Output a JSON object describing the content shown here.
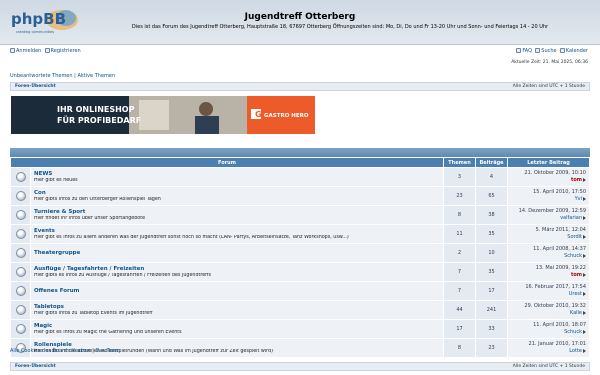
{
  "header": {
    "logo_text": "phpBB",
    "logo_tagline": "creating communities",
    "title": "Jugendtreff Otterberg",
    "description": "Dies ist das Forum des Jugendtreff Otterberg, Hauptstraße 18, 67697 Otterberg Öffnungszeiten sind: Mo, Di, Do und Fr 13-20 Uhr und Sonn- und Feiertags 14 - 20 Uhr"
  },
  "topnav": {
    "login": "Anmelden",
    "register": "Registrieren",
    "faq": "FAQ",
    "search": "Suche",
    "calendar": "Kalender"
  },
  "current_time": "Aktuelle Zeit: 21. Mai 2025, 06:36",
  "quick_links": {
    "unanswered": "Unbeantwortete Themen",
    "separator": "|",
    "active": "Aktive Themen"
  },
  "breadcrumb": {
    "index": "Foren-Übersicht",
    "timezone": "Alle Zeiten sind UTC + 1 Stunde"
  },
  "ad": {
    "line1": "IHR ONLINESHOP",
    "line2": "FÜR PROFIBEDARF",
    "brand": "GASTRO HERO"
  },
  "table": {
    "headers": {
      "forum": "Forum",
      "topics": "Themen",
      "posts": "Beiträge",
      "last_post": "Letzter Beitrag"
    },
    "rows": [
      {
        "name": "NEWS",
        "desc": "Hier gibt es neues",
        "topics": "3",
        "posts": "4",
        "date": "21. Oktober 2009, 10:10",
        "user": "tom",
        "admin": true
      },
      {
        "name": "Con",
        "desc": "Hier gibts Infos zu den Otterberger Rollenspiel Tagen",
        "topics": "23",
        "posts": "65",
        "date": "15. April 2010, 17:50",
        "user": "Yvi",
        "admin": false
      },
      {
        "name": "Turniere & Sport",
        "desc": "Hier findet ihr Infos über unser Sportangebote",
        "topics": "8",
        "posts": "38",
        "date": "14. Dezember 2009, 12:59",
        "user": "valfarian",
        "admin": false
      },
      {
        "name": "Events",
        "desc": "Hier gibt es Infos zu allem anderen was der Jugendtreff sonst noch so macht (LAN- Partys, Arbeitseinsätze, Tanz Workshops, usw...)",
        "topics": "11",
        "posts": "35",
        "date": "5. März 2011, 12:04",
        "user": "Sordit",
        "admin": false
      },
      {
        "name": "Theatergruppe",
        "desc": "",
        "topics": "2",
        "posts": "10",
        "date": "11. April 2008, 14:37",
        "user": "Schuck",
        "admin": false
      },
      {
        "name": "Ausflüge / Tagesfahrten / Freizeiten",
        "desc": "Hier gibts es Infos zu Ausflüge / Tagesfahrten / Freizeiten des Jugendtreffs",
        "topics": "7",
        "posts": "35",
        "date": "13. Mai 2009, 19:22",
        "user": "tom",
        "admin": true
      },
      {
        "name": "Offenes Forum",
        "desc": "",
        "topics": "7",
        "posts": "17",
        "date": "16. Februar 2017, 17:54",
        "user": "Urest",
        "admin": false
      },
      {
        "name": "Tabletops",
        "desc": "Hier gibts Infos zu Tabletop Events im Jugendtreff",
        "topics": "44",
        "posts": "241",
        "date": "29. Oktober 2010, 19:32",
        "user": "Kalle",
        "admin": false
      },
      {
        "name": "Magic",
        "desc": "Hier gibt es Infos zu Magic the Gathering und unseren Events",
        "topics": "17",
        "posts": "33",
        "date": "11. April 2010, 18:07",
        "user": "Schuck",
        "admin": false
      },
      {
        "name": "Rollenspiele",
        "desc": "Hier findet ihr die aktuellen Rollenspielrunden (Wann und Was im Jugendtreff zur Zeit gespielt wird)",
        "topics": "8",
        "posts": "23",
        "date": "21. Januar 2010, 17:01",
        "user": "Lotte",
        "admin": false
      }
    ]
  },
  "footer_links": {
    "delete_cookies": "Alle Cookies des Boards löschen",
    "separator": "|",
    "team": "Das Team"
  },
  "colors": {
    "header_bg": "#cfd9e4",
    "table_header": "#4b7fb1",
    "link": "#105289",
    "admin_user": "#aa0000"
  }
}
